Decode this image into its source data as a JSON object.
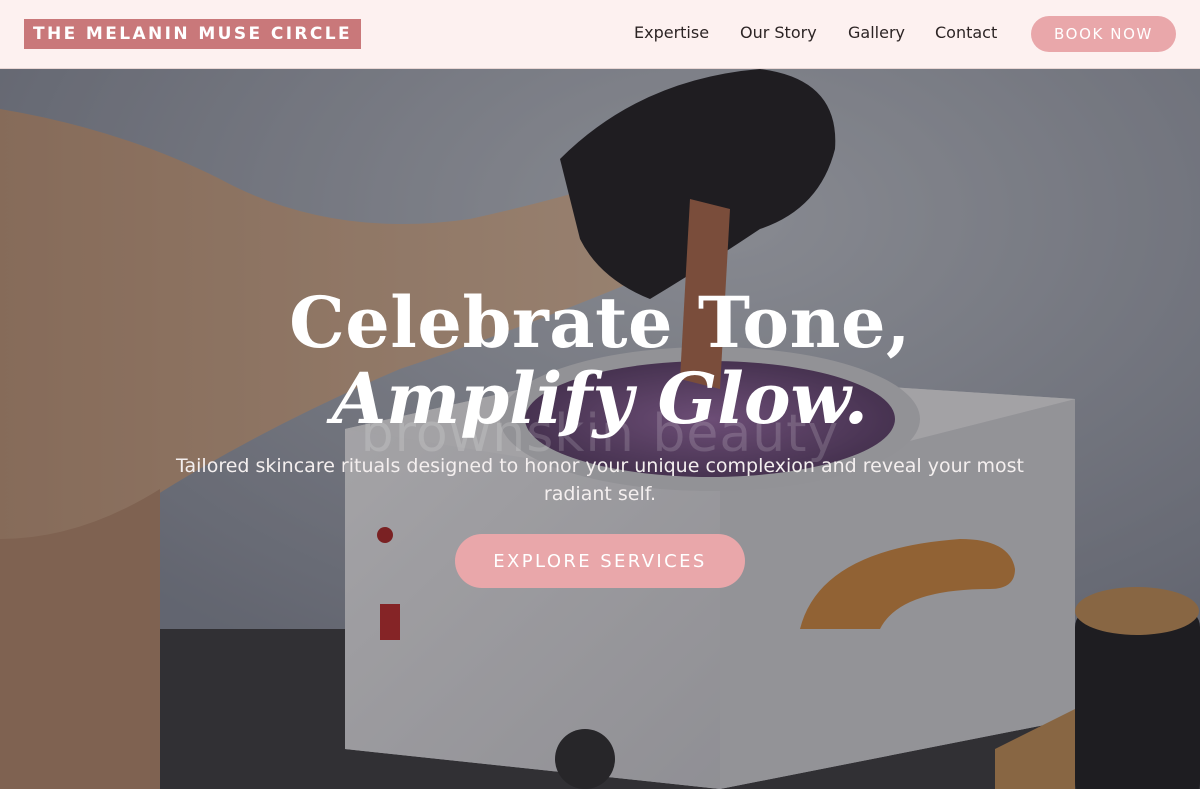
{
  "brand": {
    "logo_text": "THE MELANIN MUSE CIRCLE"
  },
  "nav": {
    "items": [
      {
        "label": "Expertise"
      },
      {
        "label": "Our Story"
      },
      {
        "label": "Gallery"
      },
      {
        "label": "Contact"
      }
    ],
    "cta_label": "BOOK NOW"
  },
  "hero": {
    "title_line1": "Celebrate Tone,",
    "title_line2": "Amplify Glow.",
    "image_watermark": "brownskin beauty",
    "subtitle": "Tailored skincare rituals designed to honor your unique complexion and reveal your most radiant self.",
    "cta_label": "EXPLORE SERVICES",
    "image_description_icon": "wax-warmer-photo"
  },
  "colors": {
    "header_bg": "#fdf1f0",
    "logo_bg": "#c9787a",
    "accent_pink": "#e9a7aa",
    "text_dark": "#2c2424",
    "white": "#ffffff"
  }
}
